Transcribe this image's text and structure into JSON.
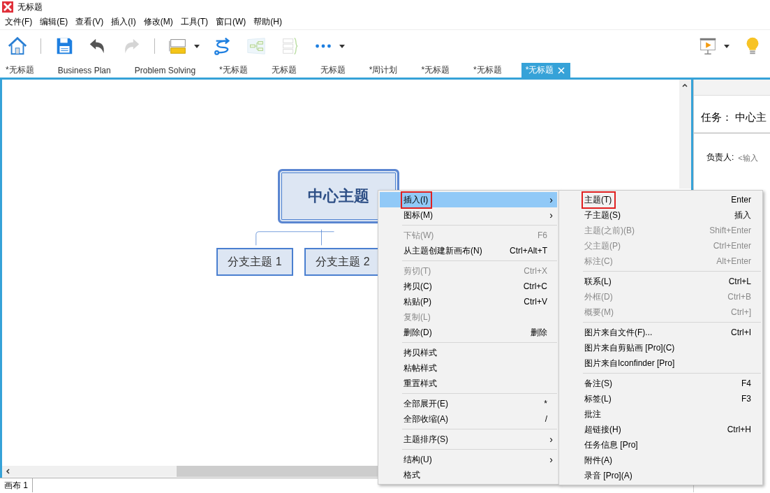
{
  "app": {
    "title": "无标题"
  },
  "menubar": [
    "文件(F)",
    "编辑(E)",
    "查看(V)",
    "插入(I)",
    "修改(M)",
    "工具(T)",
    "窗口(W)",
    "帮助(H)"
  ],
  "toolbar": [
    {
      "kind": "home",
      "disabled": false
    },
    {
      "kind": "divider"
    },
    {
      "kind": "save",
      "disabled": false
    },
    {
      "kind": "undo",
      "disabled": false
    },
    {
      "kind": "redo",
      "disabled": true
    },
    {
      "kind": "divider"
    },
    {
      "kind": "topic",
      "disabled": false
    },
    {
      "kind": "caret",
      "disabled": false
    },
    {
      "kind": "relationship",
      "disabled": false
    },
    {
      "kind": "boundary",
      "disabled": true
    },
    {
      "kind": "summary",
      "disabled": true
    },
    {
      "kind": "more",
      "disabled": false
    },
    {
      "kind": "caret",
      "disabled": false
    }
  ],
  "toolbar_right": [
    {
      "kind": "presentation",
      "disabled": false
    },
    {
      "kind": "caret",
      "disabled": false
    },
    {
      "kind": "idea",
      "disabled": false
    }
  ],
  "tabs": [
    {
      "label": "*无标题",
      "selected": false
    },
    {
      "label": "Business Plan",
      "selected": false
    },
    {
      "label": "Problem Solving",
      "selected": false
    },
    {
      "label": "*无标题",
      "selected": false
    },
    {
      "label": "无标题",
      "selected": false
    },
    {
      "label": "无标题",
      "selected": false
    },
    {
      "label": "*周计划",
      "selected": false
    },
    {
      "label": "*无标题",
      "selected": false
    },
    {
      "label": "*无标题",
      "selected": false
    },
    {
      "label": "*无标题",
      "selected": true
    }
  ],
  "mindmap": {
    "central": "中心主题",
    "branches": [
      "分支主题 1",
      "分支主题 2"
    ]
  },
  "task_panel": {
    "title": "任务：",
    "topic": "中心主",
    "assignee_label": "负责人:",
    "assignee_placeholder": "<输入"
  },
  "sheet_tabs": [
    {
      "label": "画布 1",
      "selected": true
    }
  ],
  "context_menu": [
    {
      "kind": "item",
      "label": "插入(I)",
      "arrow": "›",
      "disabled": false,
      "selected": true,
      "outlined": true
    },
    {
      "kind": "item",
      "label": "图标(M)",
      "arrow": "›",
      "disabled": false,
      "selected": false
    },
    {
      "kind": "separator"
    },
    {
      "kind": "item",
      "label": "下钻(W)",
      "shortcut": "F6",
      "disabled": true,
      "selected": false
    },
    {
      "kind": "item",
      "label": "从主题创建新画布(N)",
      "shortcut": "Ctrl+Alt+T",
      "disabled": false,
      "selected": false
    },
    {
      "kind": "separator"
    },
    {
      "kind": "item",
      "label": "剪切(T)",
      "shortcut": "Ctrl+X",
      "disabled": true,
      "selected": false
    },
    {
      "kind": "item",
      "label": "拷贝(C)",
      "shortcut": "Ctrl+C",
      "disabled": false,
      "selected": false
    },
    {
      "kind": "item",
      "label": "粘贴(P)",
      "shortcut": "Ctrl+V",
      "disabled": false,
      "selected": false
    },
    {
      "kind": "item",
      "label": "复制(L)",
      "disabled": true,
      "selected": false
    },
    {
      "kind": "item",
      "label": "删除(D)",
      "shortcut": "删除",
      "disabled": false,
      "selected": false
    },
    {
      "kind": "separator"
    },
    {
      "kind": "item",
      "label": "拷贝样式",
      "disabled": false,
      "selected": false
    },
    {
      "kind": "item",
      "label": "粘帖样式",
      "disabled": false,
      "selected": false
    },
    {
      "kind": "item",
      "label": "重置样式",
      "disabled": false,
      "selected": false
    },
    {
      "kind": "separator"
    },
    {
      "kind": "item",
      "label": "全部展开(E)",
      "shortcut": "*",
      "disabled": false,
      "selected": false
    },
    {
      "kind": "item",
      "label": "全部收缩(A)",
      "shortcut": "/",
      "disabled": false,
      "selected": false
    },
    {
      "kind": "separator"
    },
    {
      "kind": "item",
      "label": "主题排序(S)",
      "arrow": "›",
      "disabled": false,
      "selected": false
    },
    {
      "kind": "separator"
    },
    {
      "kind": "item",
      "label": "结构(U)",
      "arrow": "›",
      "disabled": false,
      "selected": false
    },
    {
      "kind": "item",
      "label": "格式",
      "disabled": false,
      "selected": false
    }
  ],
  "submenu": [
    {
      "kind": "item",
      "label": "主题(T)",
      "shortcut": "Enter",
      "disabled": false,
      "selected": false,
      "outlined": true
    },
    {
      "kind": "item",
      "label": "子主题(S)",
      "shortcut": "插入",
      "disabled": false,
      "selected": false
    },
    {
      "kind": "item",
      "label": "主题(之前)(B)",
      "shortcut": "Shift+Enter",
      "disabled": true,
      "selected": false
    },
    {
      "kind": "item",
      "label": "父主题(P)",
      "shortcut": "Ctrl+Enter",
      "disabled": true,
      "selected": false
    },
    {
      "kind": "item",
      "label": "标注(C)",
      "shortcut": "Alt+Enter",
      "disabled": true,
      "selected": false
    },
    {
      "kind": "separator"
    },
    {
      "kind": "item",
      "label": "联系(L)",
      "shortcut": "Ctrl+L",
      "disabled": false,
      "selected": false
    },
    {
      "kind": "item",
      "label": "外框(D)",
      "shortcut": "Ctrl+B",
      "disabled": true,
      "selected": false
    },
    {
      "kind": "item",
      "label": "概要(M)",
      "shortcut": "Ctrl+]",
      "disabled": true,
      "selected": false
    },
    {
      "kind": "separator"
    },
    {
      "kind": "item",
      "label": "图片来自文件(F)...",
      "shortcut": "Ctrl+I",
      "disabled": false,
      "selected": false
    },
    {
      "kind": "item",
      "label": "图片来自剪贴画 [Pro](C)",
      "disabled": false,
      "selected": false
    },
    {
      "kind": "item",
      "label": "图片来自Iconfinder [Pro]",
      "disabled": false,
      "selected": false
    },
    {
      "kind": "separator"
    },
    {
      "kind": "item",
      "label": "备注(S)",
      "shortcut": "F4",
      "disabled": false,
      "selected": false
    },
    {
      "kind": "item",
      "label": "标签(L)",
      "shortcut": "F3",
      "disabled": false,
      "selected": false
    },
    {
      "kind": "item",
      "label": "批注",
      "disabled": false,
      "selected": false
    },
    {
      "kind": "item",
      "label": "超链接(H)",
      "shortcut": "Ctrl+H",
      "disabled": false,
      "selected": false
    },
    {
      "kind": "item",
      "label": "任务信息 [Pro]",
      "disabled": false,
      "selected": false
    },
    {
      "kind": "item",
      "label": "附件(A)",
      "disabled": false,
      "selected": false
    },
    {
      "kind": "item",
      "label": "录音 [Pro](A)",
      "disabled": false,
      "selected": false
    }
  ]
}
